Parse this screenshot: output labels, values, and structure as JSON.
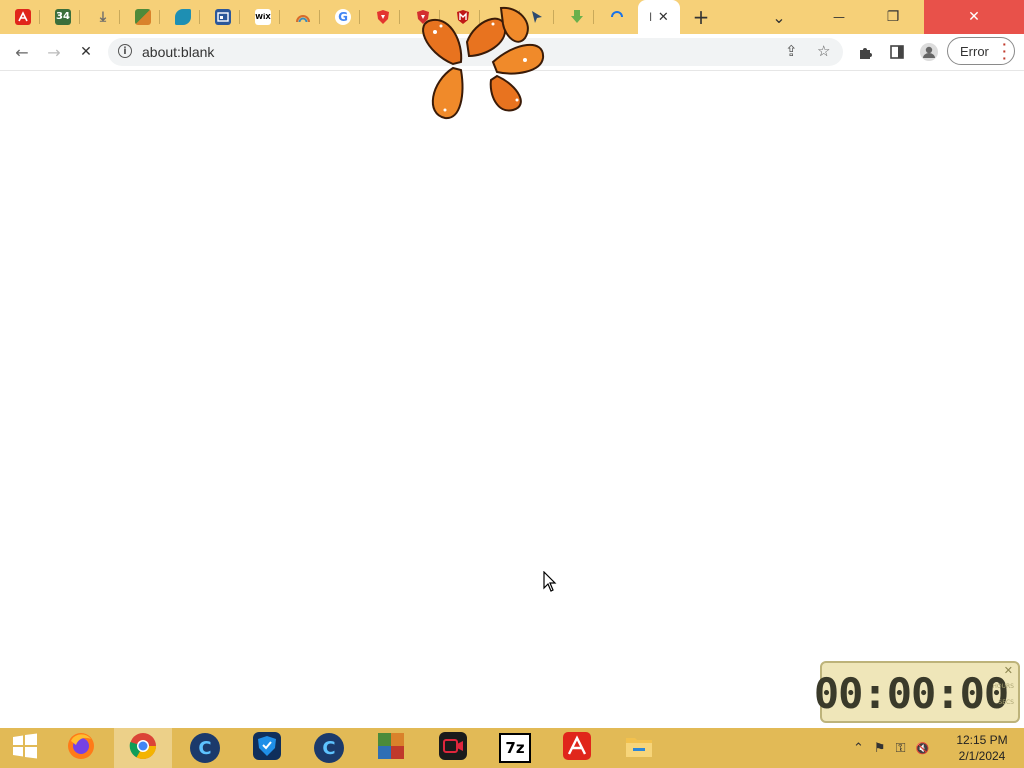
{
  "browser": {
    "tabs": [
      {
        "icon": "acrobat-icon",
        "color": "#e0261b"
      },
      {
        "icon": "game-34-icon",
        "color": "#3b6e3b",
        "text": "34"
      },
      {
        "icon": "download-icon",
        "color": "#6b6b6b"
      },
      {
        "icon": "puzzle-colorful-icon",
        "color": "#4f8a3a"
      },
      {
        "icon": "bluegreen-shape-icon",
        "color": "#1e8fb3"
      },
      {
        "icon": "calendar-window-icon",
        "color": "#2b579a"
      },
      {
        "icon": "wix-icon",
        "color": "#ffffff",
        "text": "WiX"
      },
      {
        "icon": "rainbow-icon",
        "color": "#d76b2b"
      },
      {
        "icon": "google-icon",
        "color": "#ffffff",
        "text": "G"
      },
      {
        "icon": "shield-red-icon",
        "color": "#e3342f"
      },
      {
        "icon": "shield-red-icon",
        "color": "#d32f2f"
      },
      {
        "icon": "mcafee-icon",
        "color": "#c01818"
      },
      {
        "icon": "cursor-arrow-icon",
        "color": "#2d4a6f"
      },
      {
        "icon": "green-download-icon",
        "color": "#6ab04c"
      },
      {
        "icon": "loading-spinner-icon",
        "color": "#1a73e8"
      }
    ],
    "active_tab": {
      "label": "l",
      "close": "✕"
    },
    "new_tab": "+",
    "tab_search": "⌄",
    "minimize": "—",
    "restore": "❐",
    "close": "✕",
    "toolbar": {
      "back": "←",
      "forward": "→",
      "stop": "✕",
      "url": "about:blank",
      "share": "⇪",
      "bookmark": "☆",
      "extensions": "✦",
      "sidepanel": "▯",
      "profile": "●",
      "error_label": "Error",
      "menu": "⋮"
    }
  },
  "clock_widget": {
    "time": "00:00:00",
    "close": "✕",
    "side_top": "HOURS",
    "side_bottom": "SECS"
  },
  "taskbar": {
    "start": "windows-start-icon",
    "items": [
      {
        "name": "firefox-icon",
        "color": "#ff7a18",
        "active": false
      },
      {
        "name": "chrome-icon",
        "color": "#4285f4",
        "active": true
      },
      {
        "name": "ccleaner-icon",
        "color": "#1b3a6b",
        "text": "C",
        "active": false
      },
      {
        "name": "shield-app-icon",
        "color": "#1f5fa8",
        "active": false
      },
      {
        "name": "ccleaner-icon",
        "color": "#1b3a6b",
        "text": "C",
        "active": false
      },
      {
        "name": "winrar-colorful-icon",
        "color": "#4b8b3b",
        "active": false
      },
      {
        "name": "screen-recorder-icon",
        "color": "#b5112a",
        "active": false
      },
      {
        "name": "7zip-icon",
        "color": "#ffffff",
        "text": "7z",
        "active": false
      },
      {
        "name": "acrobat-icon",
        "color": "#e0261b",
        "active": false
      },
      {
        "name": "file-explorer-icon",
        "color": "#f2c14e",
        "active": false
      }
    ],
    "tray": {
      "chevron": "⌃",
      "flag": "⚑",
      "network": "⚿",
      "volume": "🔇"
    },
    "time": "12:15 PM",
    "date": "2/1/2024"
  }
}
